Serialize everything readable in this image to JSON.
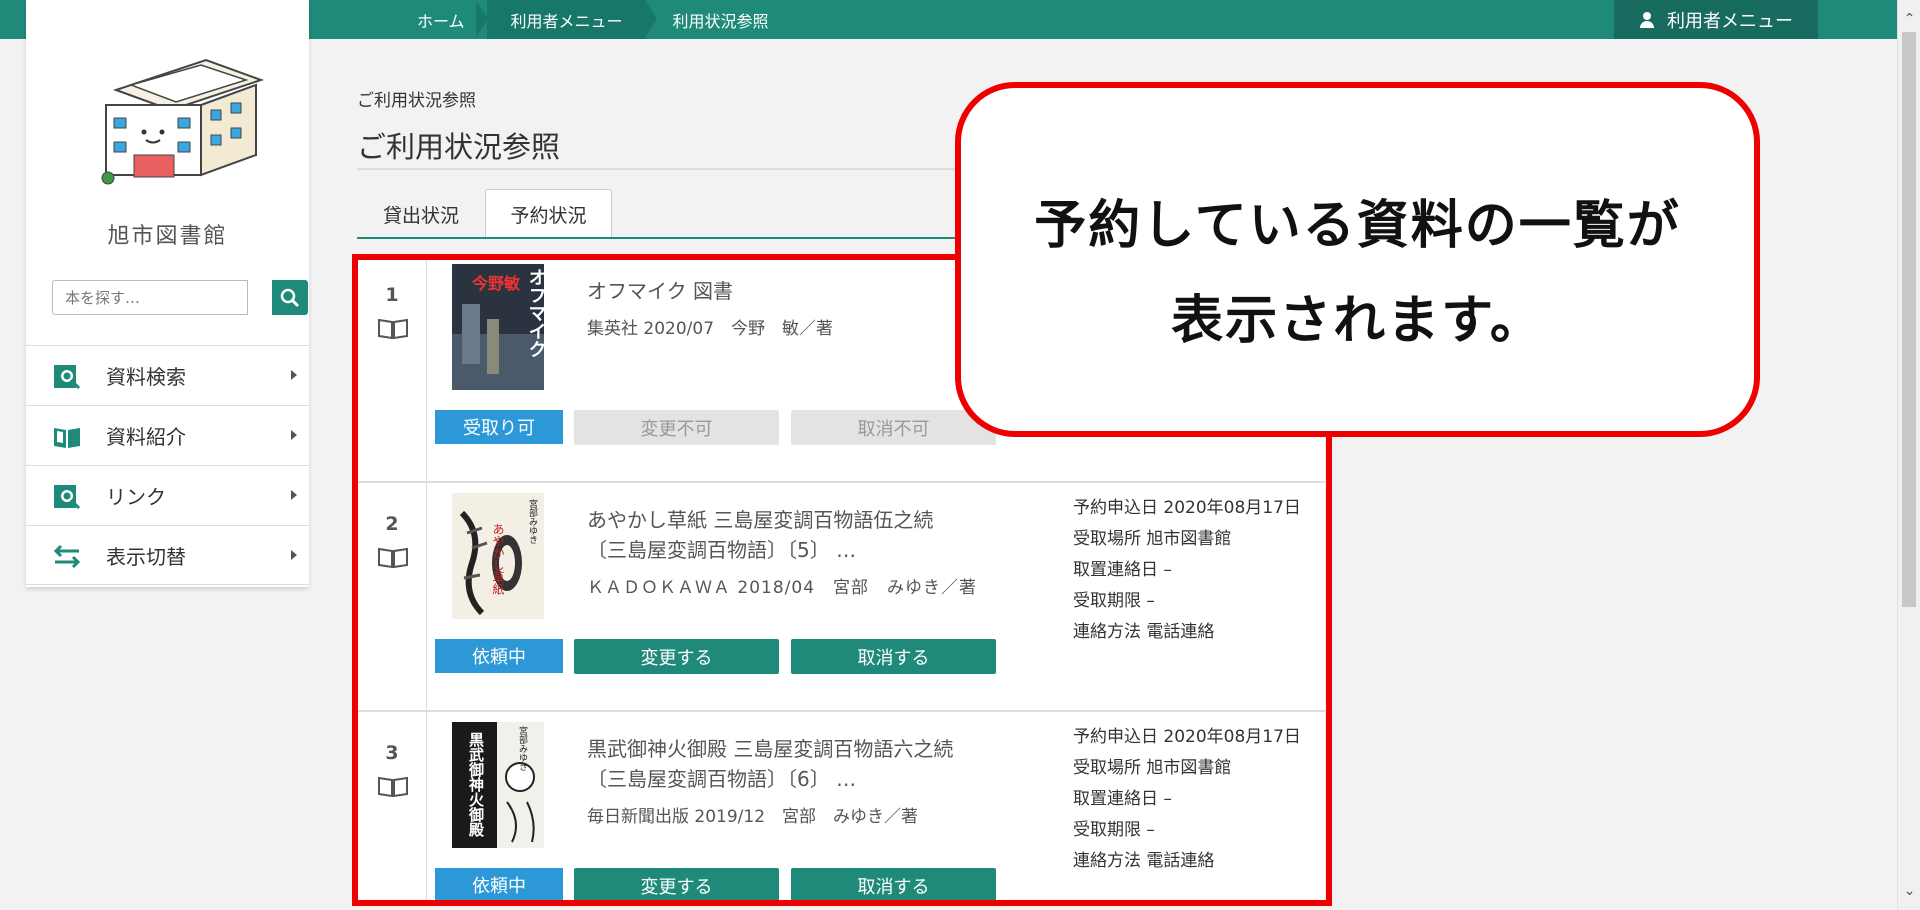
{
  "breadcrumb": [
    "ホーム",
    "利用者メニュー",
    "利用状況参照"
  ],
  "header": {
    "user_menu": "利用者メニュー"
  },
  "sidebar": {
    "library_name": "旭市図書館",
    "search_placeholder": "本を探す…",
    "items": [
      {
        "label": "資料検索",
        "icon": "book-search-icon"
      },
      {
        "label": "資料紹介",
        "icon": "open-book-icon"
      },
      {
        "label": "リンク",
        "icon": "link-search-icon"
      },
      {
        "label": "表示切替",
        "icon": "swap-arrows-icon"
      }
    ]
  },
  "page": {
    "subtitle": "ご利用状況参照",
    "title": "ご利用状況参照"
  },
  "tabs": [
    "貸出状況",
    "予約状況"
  ],
  "reservations": [
    {
      "num": "1",
      "title": "オフマイク 図書",
      "meta": "集英社 2020/07　今野　敏／著",
      "status": "受取り可",
      "change": "変更不可",
      "cancel": "取消不可",
      "cover": {
        "title": "オフマイク",
        "author": "今野敏"
      }
    },
    {
      "num": "2",
      "title_line1": "あやかし草紙 三島屋変調百物語伍之続",
      "title_line2": "〔三島屋変調百物語〕〔5〕 …",
      "meta": "ＫＡＤＯＫＡＷＡ 2018/04　宮部　みゆき／著",
      "status": "依頼中",
      "change": "変更する",
      "cancel": "取消する",
      "cover": {
        "title": "あやかし草紙",
        "author": "宮部みゆき"
      },
      "info": [
        "予約申込日 2020年08月17日",
        "受取場所 旭市図書館",
        "取置連絡日 –",
        "受取期限 –",
        "連絡方法 電話連絡"
      ]
    },
    {
      "num": "3",
      "title_line1": "黒武御神火御殿 三島屋変調百物語六之続",
      "title_line2": "〔三島屋変調百物語〕〔6〕 …",
      "meta": "毎日新聞出版 2019/12　宮部　みゆき／著",
      "status": "依頼中",
      "change": "変更する",
      "cancel": "取消する",
      "cover": {
        "title": "黒武御神火御殿",
        "author": "宮部みゆき"
      },
      "info": [
        "予約申込日 2020年08月17日",
        "受取場所 旭市図書館",
        "取置連絡日 –",
        "受取期限 –",
        "連絡方法 電話連絡"
      ]
    }
  ],
  "callout": {
    "line1": "予約している資料の一覧が",
    "line2": "表示されます。"
  },
  "colors": {
    "accent": "#1f8a7a",
    "status_blue": "#2c98d8",
    "annotation_red": "#e00000"
  }
}
